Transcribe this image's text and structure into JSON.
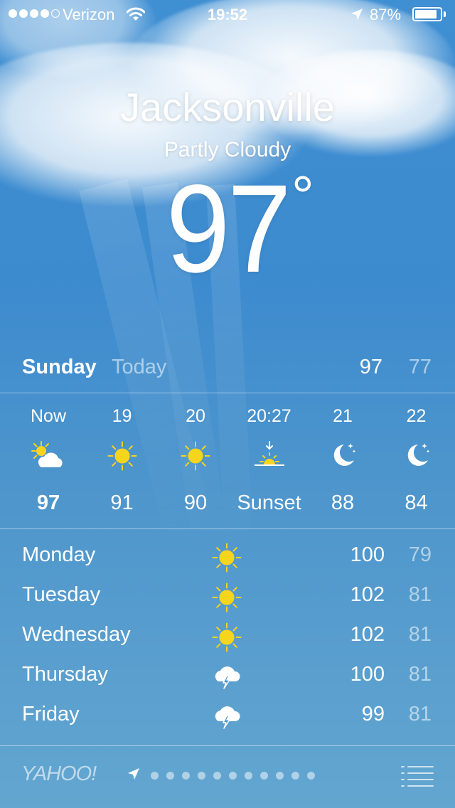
{
  "status_bar": {
    "signal_full": 4,
    "signal_total": 5,
    "carrier": "Verizon",
    "time": "19:52",
    "battery_pct": "87%",
    "battery_level": 0.87
  },
  "city": "Jacksonville",
  "condition": "Partly Cloudy",
  "temp": "97",
  "degree_symbol": "°",
  "today": {
    "day": "Sunday",
    "label": "Today",
    "hi": "97",
    "lo": "77"
  },
  "hourly": [
    {
      "label": "Now",
      "icon": "partly-cloudy-day-icon",
      "value": "97"
    },
    {
      "label": "19",
      "icon": "sun-icon",
      "value": "91"
    },
    {
      "label": "20",
      "icon": "sun-icon",
      "value": "90"
    },
    {
      "label": "20:27",
      "icon": "sunset-icon",
      "value": "Sunset"
    },
    {
      "label": "21",
      "icon": "moon-icon",
      "value": "88"
    },
    {
      "label": "22",
      "icon": "moon-icon",
      "value": "84"
    }
  ],
  "daily": [
    {
      "day": "Monday",
      "icon": "sun-icon",
      "hi": "100",
      "lo": "79"
    },
    {
      "day": "Tuesday",
      "icon": "sun-icon",
      "hi": "102",
      "lo": "81"
    },
    {
      "day": "Wednesday",
      "icon": "sun-icon",
      "hi": "102",
      "lo": "81"
    },
    {
      "day": "Thursday",
      "icon": "thunderstorm-icon",
      "hi": "100",
      "lo": "81"
    },
    {
      "day": "Friday",
      "icon": "thunderstorm-icon",
      "hi": "99",
      "lo": "81"
    }
  ],
  "footer": {
    "logo": "YAHOO!",
    "page_count": 11
  },
  "colors": {
    "sun": "#f7d51d",
    "sky_top": "#3f8fd3",
    "sky_bottom": "#63a6d0"
  }
}
